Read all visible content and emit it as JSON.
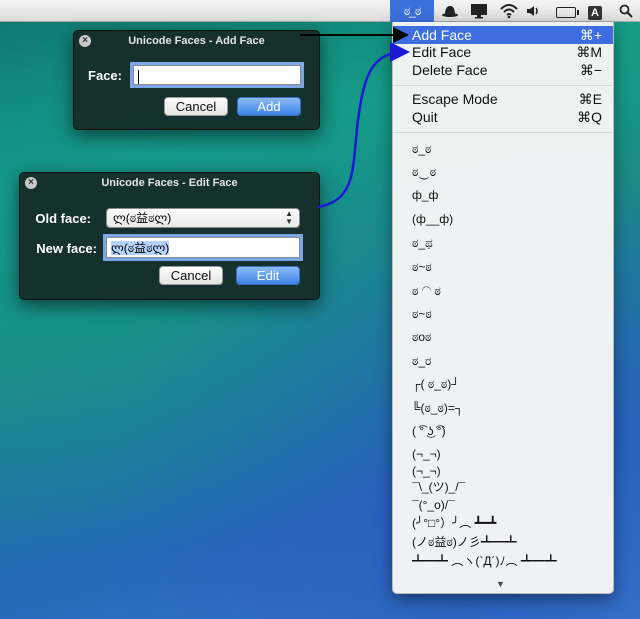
{
  "menubar": {
    "face_title": "ಠ_ಠ",
    "input_letter": "A"
  },
  "add_face_window": {
    "title": "Unicode Faces - Add Face",
    "face_label": "Face:",
    "face_value": "",
    "cancel_label": "Cancel",
    "add_label": "Add"
  },
  "edit_face_window": {
    "title": "Unicode Faces - Edit Face",
    "old_face_label": "Old face:",
    "old_face_value": "ლ(ಠ益ಠლ)",
    "new_face_label": "New face:",
    "new_face_value": "ლ(ಠ益ಠლ)",
    "cancel_label": "Cancel",
    "edit_label": "Edit"
  },
  "menu": {
    "commands": [
      {
        "label": "Add Face",
        "shortcut": "⌘+"
      },
      {
        "label": "Edit Face",
        "shortcut": "⌘M"
      },
      {
        "label": "Delete Face",
        "shortcut": "⌘−"
      },
      {
        "label": "Escape Mode",
        "shortcut": "⌘E"
      },
      {
        "label": "Quit",
        "shortcut": "⌘Q"
      }
    ],
    "faces": [
      "ಠ_ಠ",
      "ಠ‿ಠ",
      "ф_ф",
      "(ф__ф)",
      "ಠ_ಥ",
      "ಠ~ಠ",
      "ಠ ◠ ಠ",
      "ಠ~ಠ",
      "ಠoಠ",
      "ಠ_ರ",
      "┌( ಠ_ಠ)┘",
      "╚(ಠ_ಠ)=┐",
      "( ͡° ͜ʖ ͡°)",
      "(¬_¬)",
      "(¬_¬)",
      "¯\\_(ツ)_/¯",
      "¯(°_o)/¯",
      "(╯°□°）╯︵ ┻━┻",
      "(ノಠ益ಠ)ノ彡┻━┻",
      "┻━┻ ︵ヽ(`Д´)ﾉ︵ ┻━┻"
    ]
  }
}
